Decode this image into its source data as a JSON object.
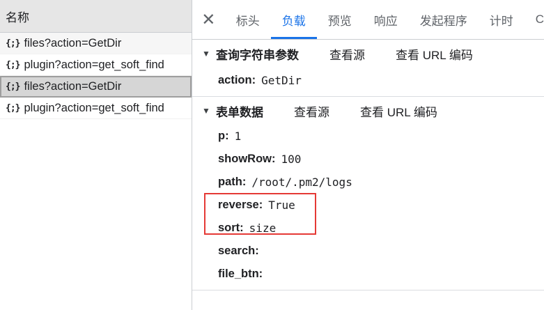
{
  "list": {
    "header": "名称",
    "icon_glyph": "{;}",
    "items": [
      {
        "label": "files?action=GetDir"
      },
      {
        "label": "plugin?action=get_soft_find"
      },
      {
        "label": "files?action=GetDir"
      },
      {
        "label": "plugin?action=get_soft_find"
      }
    ]
  },
  "tabs": {
    "close_glyph": "✕",
    "items": [
      "标头",
      "负载",
      "预览",
      "响应",
      "发起程序",
      "计时",
      "C"
    ],
    "active": "负载"
  },
  "query": {
    "title": "查询字符串参数",
    "view_source": "查看源",
    "view_url_encoded": "查看 URL 编码",
    "params": [
      {
        "key": "action:",
        "value": "GetDir"
      }
    ]
  },
  "form": {
    "title": "表单数据",
    "view_source": "查看源",
    "view_url_encoded": "查看 URL 编码",
    "params": [
      {
        "key": "p:",
        "value": "1"
      },
      {
        "key": "showRow:",
        "value": "100"
      },
      {
        "key": "path:",
        "value": "/root/.pm2/logs"
      },
      {
        "key": "reverse:",
        "value": "True"
      },
      {
        "key": "sort:",
        "value": "size"
      },
      {
        "key": "search:",
        "value": ""
      },
      {
        "key": "file_btn:",
        "value": ""
      }
    ]
  },
  "colors": {
    "accent": "#1a73e8",
    "highlight": "#e53935"
  }
}
